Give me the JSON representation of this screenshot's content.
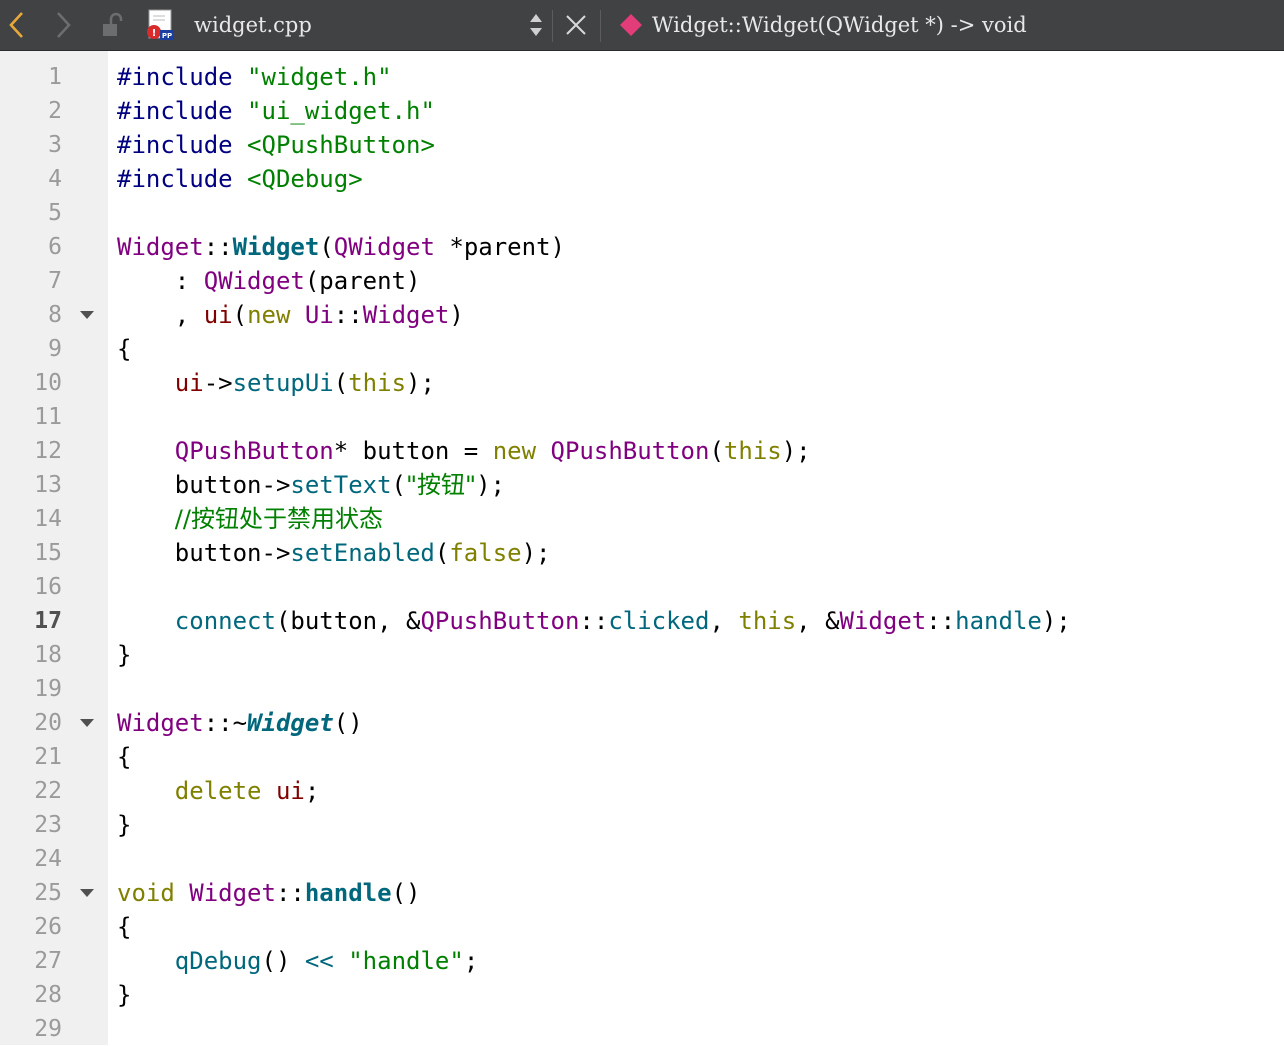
{
  "toolbar": {
    "file_name": "widget.cpp",
    "symbol": "Widget::Widget(QWidget *) -> void",
    "file_icon_label": "PP"
  },
  "editor": {
    "current_line": 17,
    "lines": [
      {
        "n": "1",
        "segs": [
          {
            "t": "#include ",
            "c": "pp"
          },
          {
            "t": "\"widget.h\"",
            "c": "str"
          }
        ]
      },
      {
        "n": "2",
        "segs": [
          {
            "t": "#include ",
            "c": "pp"
          },
          {
            "t": "\"ui_widget.h\"",
            "c": "str"
          }
        ]
      },
      {
        "n": "3",
        "segs": [
          {
            "t": "#include ",
            "c": "pp"
          },
          {
            "t": "<QPushButton>",
            "c": "str"
          }
        ]
      },
      {
        "n": "4",
        "segs": [
          {
            "t": "#include ",
            "c": "pp"
          },
          {
            "t": "<QDebug>",
            "c": "str"
          }
        ]
      },
      {
        "n": "5",
        "segs": []
      },
      {
        "n": "6",
        "segs": [
          {
            "t": "Widget",
            "c": "typ"
          },
          {
            "t": "::",
            "c": ""
          },
          {
            "t": "Widget",
            "c": "fnb"
          },
          {
            "t": "(",
            "c": ""
          },
          {
            "t": "QWidget",
            "c": "typ"
          },
          {
            "t": " *parent)",
            "c": ""
          }
        ]
      },
      {
        "n": "7",
        "segs": [
          {
            "t": "    : ",
            "c": ""
          },
          {
            "t": "QWidget",
            "c": "typ"
          },
          {
            "t": "(parent)",
            "c": ""
          }
        ]
      },
      {
        "n": "8",
        "fold": true,
        "segs": [
          {
            "t": "    , ",
            "c": ""
          },
          {
            "t": "ui",
            "c": "mem"
          },
          {
            "t": "(",
            "c": ""
          },
          {
            "t": "new",
            "c": "kw"
          },
          {
            "t": " ",
            "c": ""
          },
          {
            "t": "Ui",
            "c": "typ"
          },
          {
            "t": "::",
            "c": ""
          },
          {
            "t": "Widget",
            "c": "typ"
          },
          {
            "t": ")",
            "c": ""
          }
        ]
      },
      {
        "n": "9",
        "segs": [
          {
            "t": "{",
            "c": ""
          }
        ]
      },
      {
        "n": "10",
        "segs": [
          {
            "t": "    ",
            "c": ""
          },
          {
            "t": "ui",
            "c": "mem"
          },
          {
            "t": "->",
            "c": ""
          },
          {
            "t": "setupUi",
            "c": "fn"
          },
          {
            "t": "(",
            "c": ""
          },
          {
            "t": "this",
            "c": "kw"
          },
          {
            "t": ");",
            "c": ""
          }
        ]
      },
      {
        "n": "11",
        "segs": []
      },
      {
        "n": "12",
        "segs": [
          {
            "t": "    ",
            "c": ""
          },
          {
            "t": "QPushButton",
            "c": "typ"
          },
          {
            "t": "* button = ",
            "c": ""
          },
          {
            "t": "new",
            "c": "kw"
          },
          {
            "t": " ",
            "c": ""
          },
          {
            "t": "QPushButton",
            "c": "typ"
          },
          {
            "t": "(",
            "c": ""
          },
          {
            "t": "this",
            "c": "kw"
          },
          {
            "t": ");",
            "c": ""
          }
        ]
      },
      {
        "n": "13",
        "segs": [
          {
            "t": "    button->",
            "c": ""
          },
          {
            "t": "setText",
            "c": "fn"
          },
          {
            "t": "(",
            "c": ""
          },
          {
            "t": "\"按钮\"",
            "c": "str"
          },
          {
            "t": ");",
            "c": ""
          }
        ]
      },
      {
        "n": "14",
        "segs": [
          {
            "t": "    ",
            "c": ""
          },
          {
            "t": "//按钮处于禁用状态",
            "c": "cm"
          }
        ]
      },
      {
        "n": "15",
        "segs": [
          {
            "t": "    button->",
            "c": ""
          },
          {
            "t": "setEnabled",
            "c": "fn"
          },
          {
            "t": "(",
            "c": ""
          },
          {
            "t": "false",
            "c": "kw"
          },
          {
            "t": ");",
            "c": ""
          }
        ]
      },
      {
        "n": "16",
        "segs": []
      },
      {
        "n": "17",
        "segs": [
          {
            "t": "    ",
            "c": ""
          },
          {
            "t": "connect",
            "c": "fn"
          },
          {
            "t": "(button, &",
            "c": ""
          },
          {
            "t": "QPushButton",
            "c": "typ"
          },
          {
            "t": "::",
            "c": ""
          },
          {
            "t": "clicked",
            "c": "fn"
          },
          {
            "t": ", ",
            "c": ""
          },
          {
            "t": "this",
            "c": "kw"
          },
          {
            "t": ", &",
            "c": ""
          },
          {
            "t": "Widget",
            "c": "typ"
          },
          {
            "t": "::",
            "c": ""
          },
          {
            "t": "handle",
            "c": "fn"
          },
          {
            "t": ");",
            "c": ""
          }
        ]
      },
      {
        "n": "18",
        "segs": [
          {
            "t": "}",
            "c": ""
          }
        ]
      },
      {
        "n": "19",
        "segs": []
      },
      {
        "n": "20",
        "fold": true,
        "segs": [
          {
            "t": "Widget",
            "c": "typ"
          },
          {
            "t": "::~",
            "c": ""
          },
          {
            "t": "Widget",
            "c": "fnbi"
          },
          {
            "t": "()",
            "c": ""
          }
        ]
      },
      {
        "n": "21",
        "segs": [
          {
            "t": "{",
            "c": ""
          }
        ]
      },
      {
        "n": "22",
        "segs": [
          {
            "t": "    ",
            "c": ""
          },
          {
            "t": "delete",
            "c": "kw"
          },
          {
            "t": " ",
            "c": ""
          },
          {
            "t": "ui",
            "c": "mem"
          },
          {
            "t": ";",
            "c": ""
          }
        ]
      },
      {
        "n": "23",
        "segs": [
          {
            "t": "}",
            "c": ""
          }
        ]
      },
      {
        "n": "24",
        "segs": []
      },
      {
        "n": "25",
        "fold": true,
        "segs": [
          {
            "t": "void",
            "c": "kw"
          },
          {
            "t": " ",
            "c": ""
          },
          {
            "t": "Widget",
            "c": "typ"
          },
          {
            "t": "::",
            "c": ""
          },
          {
            "t": "handle",
            "c": "fnb"
          },
          {
            "t": "()",
            "c": ""
          }
        ]
      },
      {
        "n": "26",
        "segs": [
          {
            "t": "{",
            "c": ""
          }
        ]
      },
      {
        "n": "27",
        "segs": [
          {
            "t": "    ",
            "c": ""
          },
          {
            "t": "qDebug",
            "c": "fn"
          },
          {
            "t": "() ",
            "c": ""
          },
          {
            "t": "<<",
            "c": "fn"
          },
          {
            "t": " ",
            "c": ""
          },
          {
            "t": "\"handle\"",
            "c": "str"
          },
          {
            "t": ";",
            "c": ""
          }
        ]
      },
      {
        "n": "28",
        "segs": [
          {
            "t": "}",
            "c": ""
          }
        ]
      },
      {
        "n": "29",
        "segs": []
      }
    ]
  }
}
